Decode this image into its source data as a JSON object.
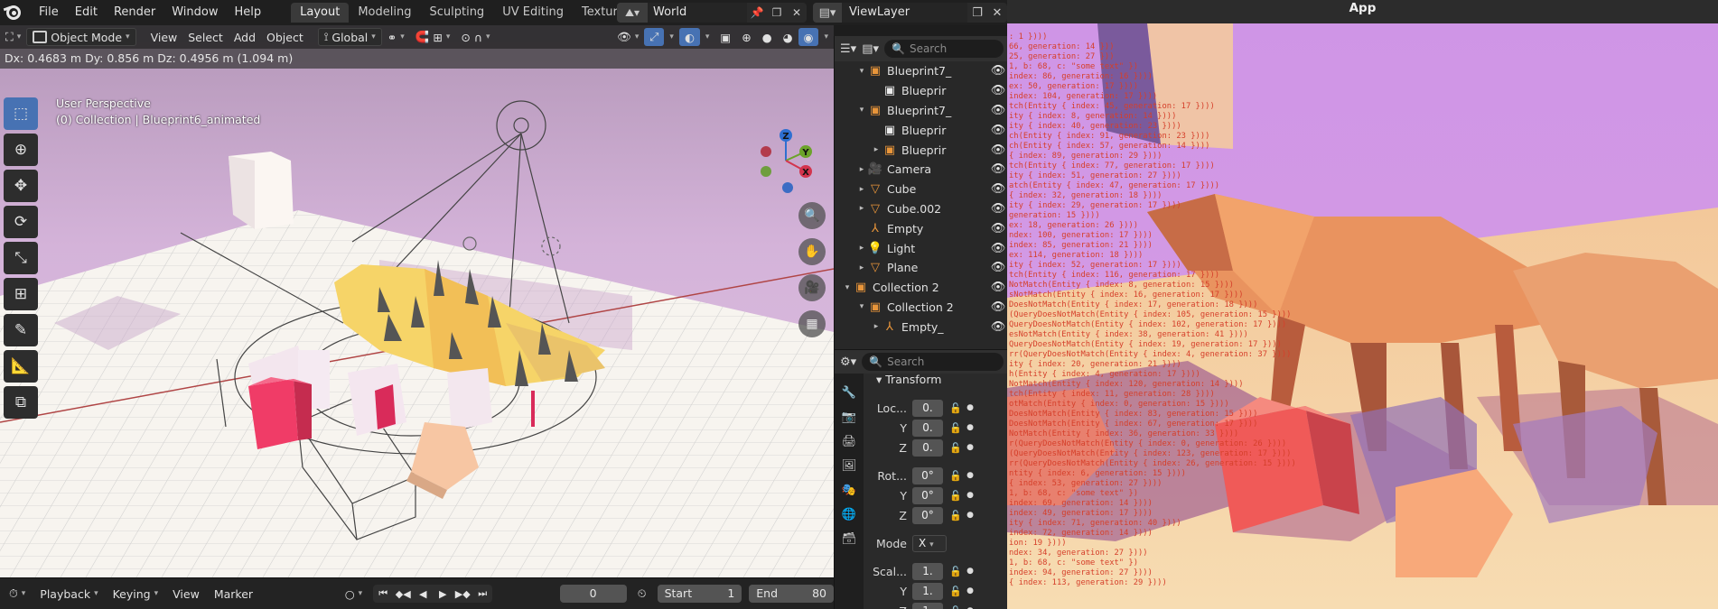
{
  "blender": {
    "menu": [
      "File",
      "Edit",
      "Render",
      "Window",
      "Help"
    ],
    "workspaces": [
      "Layout",
      "Modeling",
      "Sculpting",
      "UV Editing",
      "Texture Paint"
    ],
    "active_workspace": "Layout",
    "scene_name": "World",
    "view_layer": "ViewLayer"
  },
  "viewport": {
    "mode": "Object Mode",
    "menus": [
      "View",
      "Select",
      "Add",
      "Object"
    ],
    "orientation": "Global",
    "status": "Dx: 0.4683 m   Dy: 0.856 m   Dz: 0.4956 m (1.094 m)",
    "perspective": "User Perspective",
    "collection_info": "(0) Collection | Blueprint6_animated",
    "gizmo_axes": [
      "X",
      "Y",
      "Z"
    ]
  },
  "timeline": {
    "playback": "Playback",
    "keying": "Keying",
    "view": "View",
    "marker": "Marker",
    "current_frame": "0",
    "start_label": "Start",
    "start_value": "1",
    "end_label": "End",
    "end_value": "80"
  },
  "outliner": {
    "search_placeholder": "Search",
    "rows": [
      {
        "label": "Blueprint7_",
        "depth": 2,
        "expanded": true,
        "icon": "collection-icon"
      },
      {
        "label": "Blueprir",
        "depth": 3,
        "expanded": null,
        "icon": "object-icon"
      },
      {
        "label": "Blueprint7_",
        "depth": 2,
        "expanded": true,
        "icon": "collection-icon"
      },
      {
        "label": "Blueprir",
        "depth": 3,
        "expanded": null,
        "icon": "object-icon"
      },
      {
        "label": "Blueprir",
        "depth": 3,
        "expanded": false,
        "icon": "collection-icon"
      },
      {
        "label": "Camera",
        "depth": 2,
        "expanded": false,
        "icon": "camera-icon"
      },
      {
        "label": "Cube",
        "depth": 2,
        "expanded": false,
        "icon": "mesh-icon"
      },
      {
        "label": "Cube.002",
        "depth": 2,
        "expanded": false,
        "icon": "mesh-icon"
      },
      {
        "label": "Empty",
        "depth": 2,
        "expanded": null,
        "icon": "empty-icon"
      },
      {
        "label": "Light",
        "depth": 2,
        "expanded": false,
        "icon": "light-icon"
      },
      {
        "label": "Plane",
        "depth": 2,
        "expanded": false,
        "icon": "mesh-icon"
      },
      {
        "label": "Collection 2",
        "depth": 1,
        "expanded": true,
        "icon": "collection-icon"
      },
      {
        "label": "Collection 2",
        "depth": 2,
        "expanded": true,
        "icon": "collection-icon"
      },
      {
        "label": "Empty_",
        "depth": 3,
        "expanded": false,
        "icon": "empty-icon"
      }
    ]
  },
  "properties": {
    "search_placeholder": "Search",
    "panel_title": "Transform",
    "location_label": "Loc...",
    "rotation_label": "Rot...",
    "scale_label": "Scal...",
    "mode_label": "Mode",
    "mode_value": "X",
    "axis_y": "Y",
    "axis_z": "Z",
    "loc_values": [
      "0.",
      "0.",
      "0."
    ],
    "rot_values": [
      "0°",
      "0°",
      "0°"
    ],
    "scale_values": [
      "1.",
      "1.",
      "1."
    ]
  },
  "app": {
    "title": "App",
    "console_lines": [
      ": 1 })))",
      "66, generation: 14 }))",
      "25, generation: 27 }))",
      "1, b: 68, c: \"some text\" })",
      "index: 86, generation: 16 })))",
      "ex: 50, generation: 17 })))",
      "index: 104, generation: 17 })))",
      "tch(Entity { index: 45, generation: 17 })))",
      "ity { index: 8, generation: 14 })))",
      "ity { index: 40, generation: 23 })))",
      "ch(Entity { index: 91, generation: 23 })))",
      "ch(Entity { index: 57, generation: 14 })))",
      "{ index: 89, generation: 29 })))",
      "tch(Entity { index: 77, generation: 17 })))",
      "ity { index: 51, generation: 27 })))",
      "atch(Entity { index: 47, generation: 17 })))",
      "{ index: 32, generation: 18 })))",
      "ity { index: 29, generation: 17 })))",
      "generation: 15 })))",
      "ex: 18, generation: 26 })))",
      "ndex: 100, generation: 17 })))",
      "index: 85, generation: 21 })))",
      "ex: 114, generation: 18 })))",
      "ity { index: 52, generation: 17 })))",
      "tch(Entity { index: 116, generation: 17 })))",
      "NotMatch(Entity { index: 8, generation: 15 })))",
      "sNotMatch(Entity { index: 16, generation: 17 })))",
      "DoesNotMatch(Entity { index: 17, generation: 18 })))",
      "(QueryDoesNotMatch(Entity { index: 105, generation: 15 })))",
      "QueryDoesNotMatch(Entity { index: 102, generation: 17 })))",
      "esNotMatch(Entity { index: 38, generation: 41 })))",
      "QueryDoesNotMatch(Entity { index: 19, generation: 17 })))",
      "rr(QueryDoesNotMatch(Entity { index: 4, generation: 37 })))",
      "ity { index: 20, generation: 21 })))",
      "h(Entity { index: 4, generation: 17 })))",
      "NotMatch(Entity { index: 120, generation: 14 })))",
      "tch(Entity { index: 11, generation: 28 })))",
      "otMatch(Entity { index: 0, generation: 15 })))",
      "DoesNotMatch(Entity { index: 83, generation: 15 })))",
      "DoesNotMatch(Entity { index: 67, generation: 17 })))",
      "NotMatch(Entity { index: 36, generation: 33 })))",
      "r(QueryDoesNotMatch(Entity { index: 0, generation: 26 })))",
      "(QueryDoesNotMatch(Entity { index: 123, generation: 17 })))",
      "rr(QueryDoesNotMatch(Entity { index: 26, generation: 15 })))",
      "ntity { index: 6, generation: 15 })))",
      "{ index: 53, generation: 27 })))",
      "1, b: 68, c: \"some text\" })",
      "index: 69, generation: 14 })))",
      "index: 49, generation: 17 })))",
      "ity { index: 71, generation: 40 })))",
      "index: 72, generation: 14 })))",
      "ion: 19 })))",
      "ndex: 34, generation: 27 })))",
      "1, b: 68, c: \"some text\" })",
      "index: 94, generation: 27 })))",
      "{ index: 113, generation: 29 })))"
    ]
  }
}
